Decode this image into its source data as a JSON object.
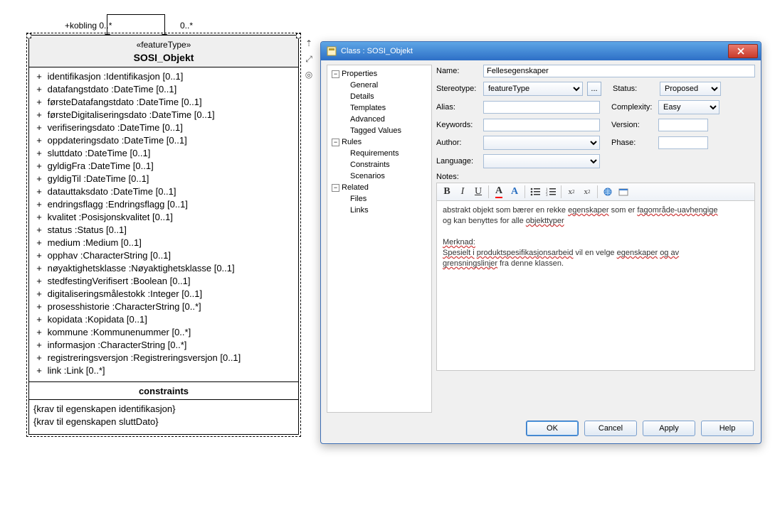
{
  "uml": {
    "role_label": "+kobling 0..*",
    "role_label2": "0..*",
    "stereotype": "«featureType»",
    "class_name": "SOSI_Objekt",
    "attributes": [
      {
        "vis": "+",
        "text": "identifikasjon  :Identifikasjon [0..1]"
      },
      {
        "vis": "+",
        "text": "datafangstdato  :DateTime [0..1]"
      },
      {
        "vis": "+",
        "text": "førsteDatafangstdato  :DateTime [0..1]"
      },
      {
        "vis": "+",
        "text": "førsteDigitaliseringsdato  :DateTime [0..1]"
      },
      {
        "vis": "+",
        "text": "verifiseringsdato  :DateTime [0..1]"
      },
      {
        "vis": "+",
        "text": "oppdateringsdato  :DateTime [0..1]"
      },
      {
        "vis": "+",
        "text": "sluttdato  :DateTime [0..1]"
      },
      {
        "vis": "+",
        "text": "gyldigFra  :DateTime [0..1]"
      },
      {
        "vis": "+",
        "text": "gyldigTil  :DateTime [0..1]"
      },
      {
        "vis": "+",
        "text": "datauttaksdato  :DateTime [0..1]"
      },
      {
        "vis": "+",
        "text": "endringsflagg  :Endringsflagg [0..1]"
      },
      {
        "vis": "+",
        "text": "kvalitet  :Posisjonskvalitet [0..1]"
      },
      {
        "vis": "+",
        "text": "status  :Status [0..1]"
      },
      {
        "vis": "+",
        "text": "medium  :Medium [0..1]"
      },
      {
        "vis": "+",
        "text": "opphav  :CharacterString [0..1]"
      },
      {
        "vis": "+",
        "text": "nøyaktighetsklasse  :Nøyaktighetsklasse [0..1]"
      },
      {
        "vis": "+",
        "text": "stedfestingVerifisert  :Boolean [0..1]"
      },
      {
        "vis": "+",
        "text": "digitaliseringsmålestokk  :Integer [0..1]"
      },
      {
        "vis": "+",
        "text": "prosesshistorie  :CharacterString [0..*]"
      },
      {
        "vis": "+",
        "text": "kopidata  :Kopidata [0..1]"
      },
      {
        "vis": "+",
        "text": "kommune  :Kommunenummer [0..*]"
      },
      {
        "vis": "+",
        "text": "informasjon  :CharacterString [0..*]"
      },
      {
        "vis": "+",
        "text": "registreringsversjon  :Registreringsversjon [0..1]"
      },
      {
        "vis": "+",
        "text": "link  :Link [0..*]"
      }
    ],
    "constraints_header": "constraints",
    "constraints": [
      "{krav til egenskapen identifikasjon}",
      "{krav til egenskapen sluttDato}"
    ]
  },
  "dialog": {
    "title": "Class : SOSI_Objekt",
    "tree": {
      "properties": {
        "label": "Properties",
        "items": [
          "General",
          "Details",
          "Templates",
          "Advanced",
          "Tagged Values"
        ]
      },
      "rules": {
        "label": "Rules",
        "items": [
          "Requirements",
          "Constraints",
          "Scenarios"
        ]
      },
      "related": {
        "label": "Related",
        "items": [
          "Files",
          "Links"
        ]
      }
    },
    "fields": {
      "name_label": "Name:",
      "name_value": "Fellesegenskaper",
      "stereotype_label": "Stereotype:",
      "stereotype_value": "featureType",
      "status_label": "Status:",
      "status_value": "Proposed",
      "alias_label": "Alias:",
      "alias_value": "",
      "complexity_label": "Complexity:",
      "complexity_value": "Easy",
      "keywords_label": "Keywords:",
      "keywords_value": "",
      "version_label": "Version:",
      "version_value": "",
      "author_label": "Author:",
      "author_value": "",
      "phase_label": "Phase:",
      "phase_value": "",
      "language_label": "Language:",
      "language_value": "",
      "notes_label": "Notes:"
    },
    "notes": {
      "line1a": "abstrakt objekt som bærer en rekke",
      "line1b": "egenskaper",
      "line1c": "som er",
      "line1d": "fagområde-uavhengige",
      "line2a": "og kan benyttes for alle",
      "line2b": "objekttyper",
      "line3": "Merknad:",
      "line4a": "Spesielt i",
      "line4b": "produktspesifikasjonsarbeid",
      "line4c": "vil en velge",
      "line4d": "egenskaper",
      "line4e": "og av",
      "line5a": "grensningslinjer",
      "line5b": "fra denne klassen."
    },
    "buttons": {
      "ok": "OK",
      "cancel": "Cancel",
      "apply": "Apply",
      "help": "Help"
    }
  }
}
